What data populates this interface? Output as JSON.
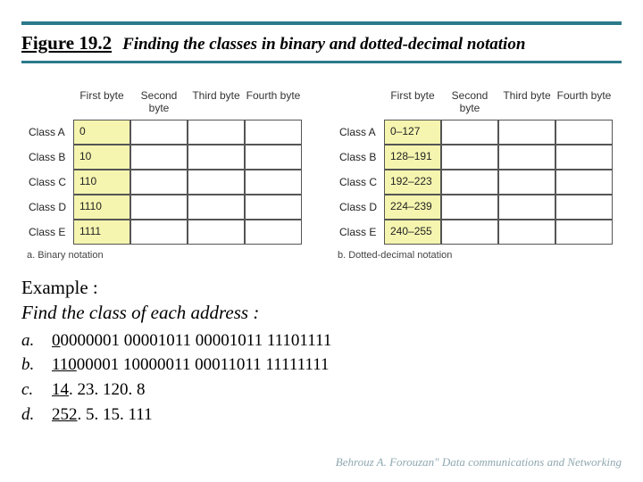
{
  "figure": {
    "label": "Figure 19.2",
    "caption": "Finding the classes in binary and dotted-decimal notation"
  },
  "tables": {
    "headers": [
      "First byte",
      "Second byte",
      "Third byte",
      "Fourth byte"
    ],
    "rowLabels": [
      "Class A",
      "Class B",
      "Class C",
      "Class D",
      "Class E"
    ],
    "binary": {
      "caption": "a. Binary notation",
      "firstByte": [
        "0",
        "10",
        "110",
        "1110",
        "1111"
      ]
    },
    "decimal": {
      "caption": "b. Dotted-decimal notation",
      "firstByte": [
        "0–127",
        "128–191",
        "192–223",
        "224–239",
        "240–255"
      ]
    }
  },
  "example": {
    "line1": "Example :",
    "line2": "Find the class of each address :",
    "items": [
      {
        "marker": "a.",
        "uPart": "0",
        "rest": "0000001 00001011 00001011 11101111"
      },
      {
        "marker": "b.",
        "uPart": "110",
        "rest": "00001 10000011 00011011 11111111"
      },
      {
        "marker": "c.",
        "uPart": "14",
        "rest": ". 23. 120. 8"
      },
      {
        "marker": "d.",
        "uPart": "252",
        "rest": ". 5. 15. 111"
      }
    ]
  },
  "footer": "Behrouz A. Forouzan\" Data communications and Networking"
}
